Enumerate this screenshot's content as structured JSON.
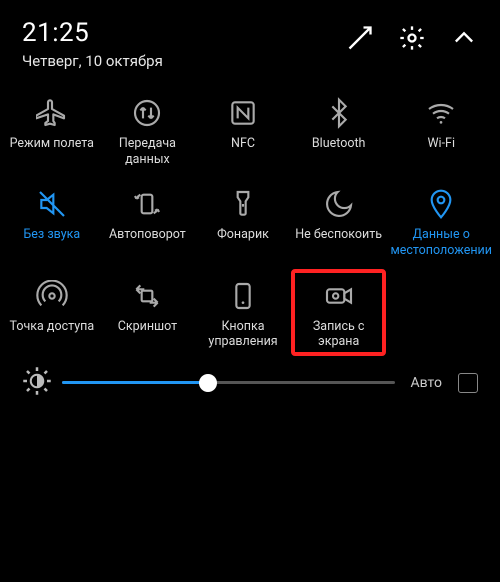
{
  "header": {
    "time": "21:25",
    "date": "Четверг, 10 октября"
  },
  "colors": {
    "accent": "#2196f3",
    "highlight": "#f22"
  },
  "tiles": [
    {
      "id": "airplane-mode",
      "label": "Режим полета",
      "active": false
    },
    {
      "id": "data-transfer",
      "label": "Передача данных",
      "active": false
    },
    {
      "id": "nfc",
      "label": "NFC",
      "active": false
    },
    {
      "id": "bluetooth",
      "label": "Bluetooth",
      "active": false
    },
    {
      "id": "wifi",
      "label": "Wi-Fi",
      "active": false
    },
    {
      "id": "mute",
      "label": "Без звука",
      "active": true
    },
    {
      "id": "auto-rotate",
      "label": "Автоповорот",
      "active": false
    },
    {
      "id": "flashlight",
      "label": "Фонарик",
      "active": false
    },
    {
      "id": "dnd",
      "label": "Не беспокоить",
      "active": false
    },
    {
      "id": "location",
      "label": "Данные о местоположении",
      "active": true
    },
    {
      "id": "hotspot",
      "label": "Точка доступа",
      "active": false
    },
    {
      "id": "screenshot",
      "label": "Скриншот",
      "active": false
    },
    {
      "id": "control-button",
      "label": "Кнопка управления",
      "active": false
    },
    {
      "id": "screen-record",
      "label": "Запись с экрана",
      "active": false,
      "highlighted": true
    }
  ],
  "brightness": {
    "value": 44,
    "auto_label": "Авто",
    "auto_checked": false
  }
}
